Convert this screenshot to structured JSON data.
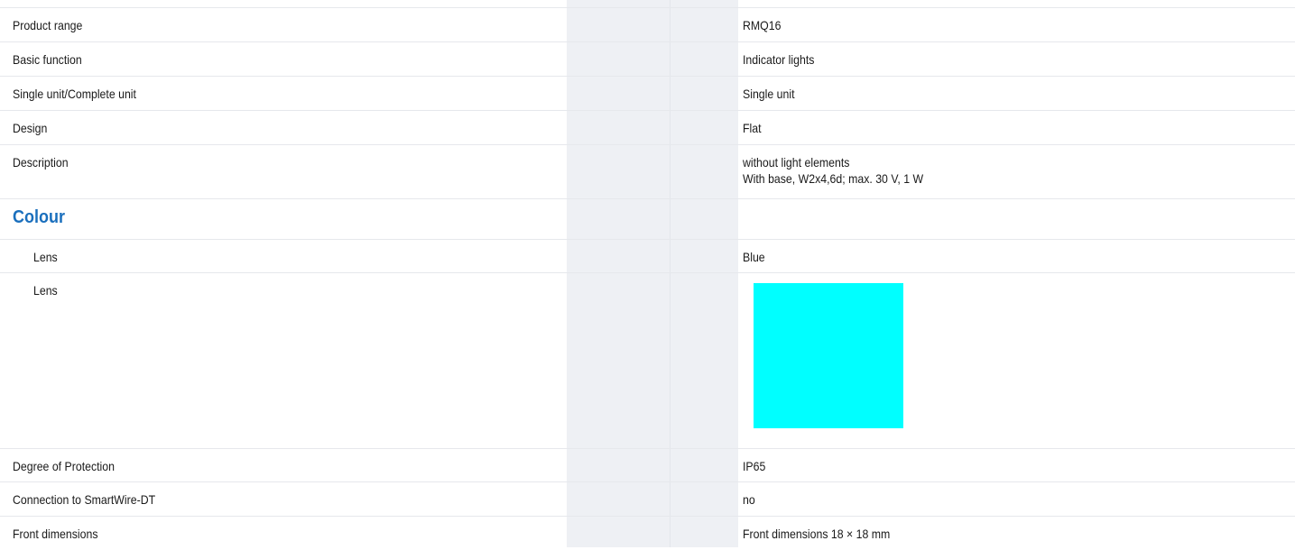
{
  "swatch_color": "#00ffff",
  "accent_color": "#1a6fbd",
  "rows": [
    {
      "label": "Product range",
      "value": "RMQ16"
    },
    {
      "label": "Basic function",
      "value": "Indicator lights"
    },
    {
      "label": "Single unit/Complete unit",
      "value": "Single unit"
    },
    {
      "label": "Design",
      "value": "Flat"
    },
    {
      "label": "Description",
      "value_lines": [
        "without light elements",
        "With base, W2x4,6d; max. 30 V, 1 W"
      ]
    },
    {
      "section": "Colour"
    },
    {
      "label": "Lens",
      "value": "Blue"
    },
    {
      "label": "Lens",
      "swatch": "cyan color swatch"
    },
    {
      "label": "Degree of Protection",
      "value": "IP65"
    },
    {
      "label": "Connection to SmartWire-DT",
      "value": "no"
    },
    {
      "label": "Front dimensions",
      "value": "Front dimensions 18 × 18 mm"
    }
  ]
}
